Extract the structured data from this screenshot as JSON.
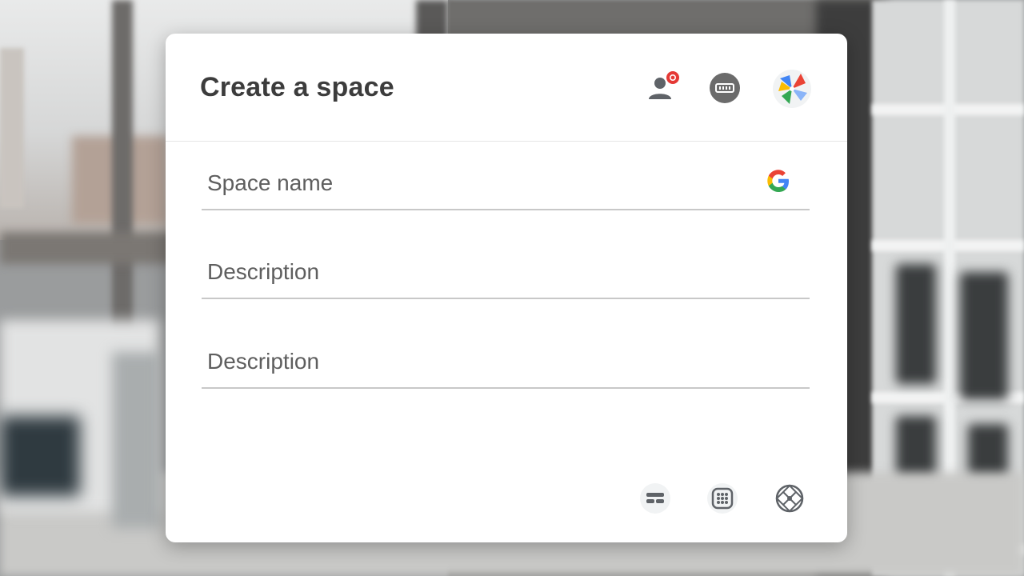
{
  "dialog": {
    "title": "Create a space",
    "header_icons": [
      "add-person-icon",
      "keyboard-icon",
      "pinwheel-app-icon"
    ],
    "notification_badge": "0"
  },
  "fields": [
    {
      "label": "Space name",
      "value": "",
      "trailing_icon": "google-g-icon"
    },
    {
      "label": "Description",
      "value": ""
    },
    {
      "label": "Description",
      "value": ""
    }
  ],
  "footer_icons": [
    "format-icon",
    "grid-icon",
    "globe-icon"
  ],
  "colors": {
    "badge": "#e53935",
    "text": "#3c3c3c",
    "label": "#5e5e5e",
    "underline": "#c8c8c8"
  }
}
